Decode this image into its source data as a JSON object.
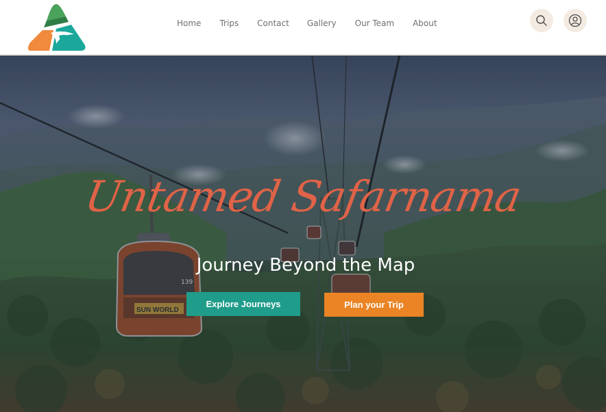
{
  "header": {
    "logo": {
      "icon": "triangle-mountain-logo",
      "colors": [
        "#2e8f4f",
        "#f08a3c",
        "#1ba89b"
      ]
    },
    "nav": [
      {
        "label": "Home"
      },
      {
        "label": "Trips"
      },
      {
        "label": "Contact"
      },
      {
        "label": "Gallery"
      },
      {
        "label": "Our Team"
      },
      {
        "label": "About"
      }
    ],
    "search_icon": "search-icon",
    "user_icon": "user-circle-icon"
  },
  "hero": {
    "script_title": "Untamed Safarnama",
    "subtitle": "Journey Beyond the Map",
    "cabin_number": "139",
    "cabin_brand": "SUN WORLD",
    "primary_button": {
      "label": "Explore Journeys",
      "color": "#1f9c8a"
    },
    "secondary_button": {
      "label": "Plan your Trip",
      "color": "#ea8425"
    },
    "title_color": "#e06347"
  }
}
